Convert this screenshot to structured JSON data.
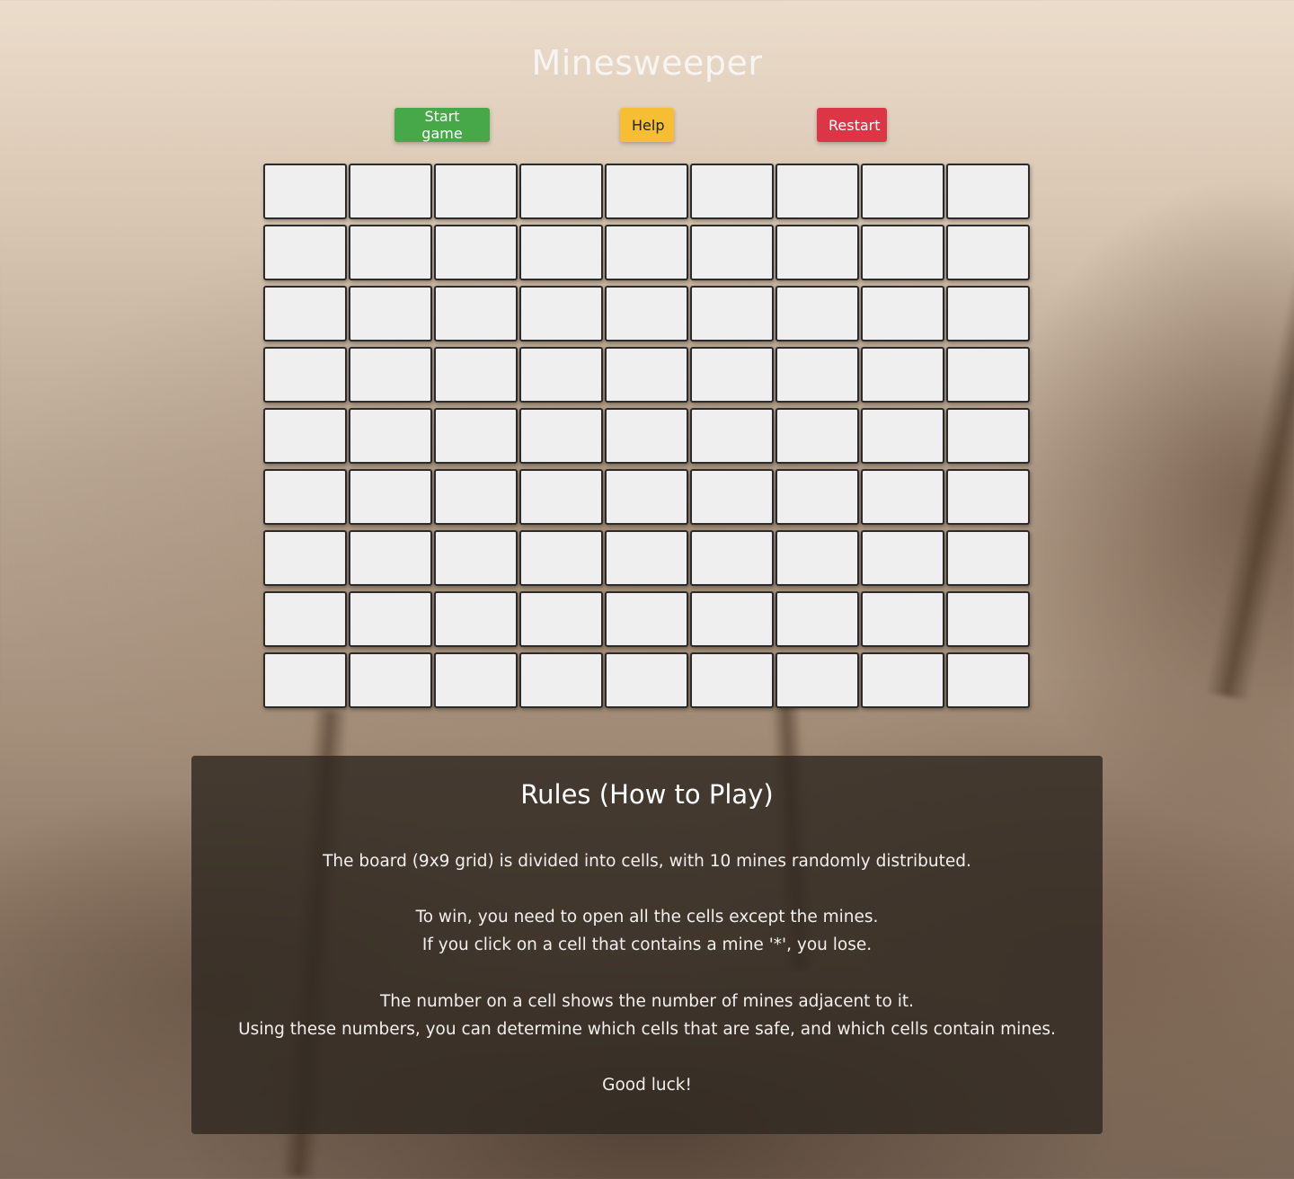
{
  "page": {
    "title": "Minesweeper"
  },
  "controls": {
    "start_label": "Start game",
    "help_label": "Help",
    "restart_label": "Restart",
    "start_color": "#47a84a",
    "help_color": "#f5be33",
    "restart_color": "#dc3545"
  },
  "board": {
    "rows": 9,
    "cols": 9,
    "mines": 10,
    "cells": [
      [
        "",
        "",
        "",
        "",
        "",
        "",
        "",
        "",
        ""
      ],
      [
        "",
        "",
        "",
        "",
        "",
        "",
        "",
        "",
        ""
      ],
      [
        "",
        "",
        "",
        "",
        "",
        "",
        "",
        "",
        ""
      ],
      [
        "",
        "",
        "",
        "",
        "",
        "",
        "",
        "",
        ""
      ],
      [
        "",
        "",
        "",
        "",
        "",
        "",
        "",
        "",
        ""
      ],
      [
        "",
        "",
        "",
        "",
        "",
        "",
        "",
        "",
        ""
      ],
      [
        "",
        "",
        "",
        "",
        "",
        "",
        "",
        "",
        ""
      ],
      [
        "",
        "",
        "",
        "",
        "",
        "",
        "",
        "",
        ""
      ],
      [
        "",
        "",
        "",
        "",
        "",
        "",
        "",
        "",
        ""
      ]
    ]
  },
  "rules": {
    "title": "Rules (How to Play)",
    "line1": "The board (9x9 grid) is divided into cells, with 10 mines randomly distributed.",
    "line2": "To win, you need to open all the cells except the mines.",
    "line3": "If you click on a cell that contains a mine '*', you lose.",
    "line4": "The number on a cell shows the number of mines adjacent to it.",
    "line5": "Using these numbers, you can determine which cells that are safe, and which cells contain mines.",
    "line6": "Good luck!"
  }
}
